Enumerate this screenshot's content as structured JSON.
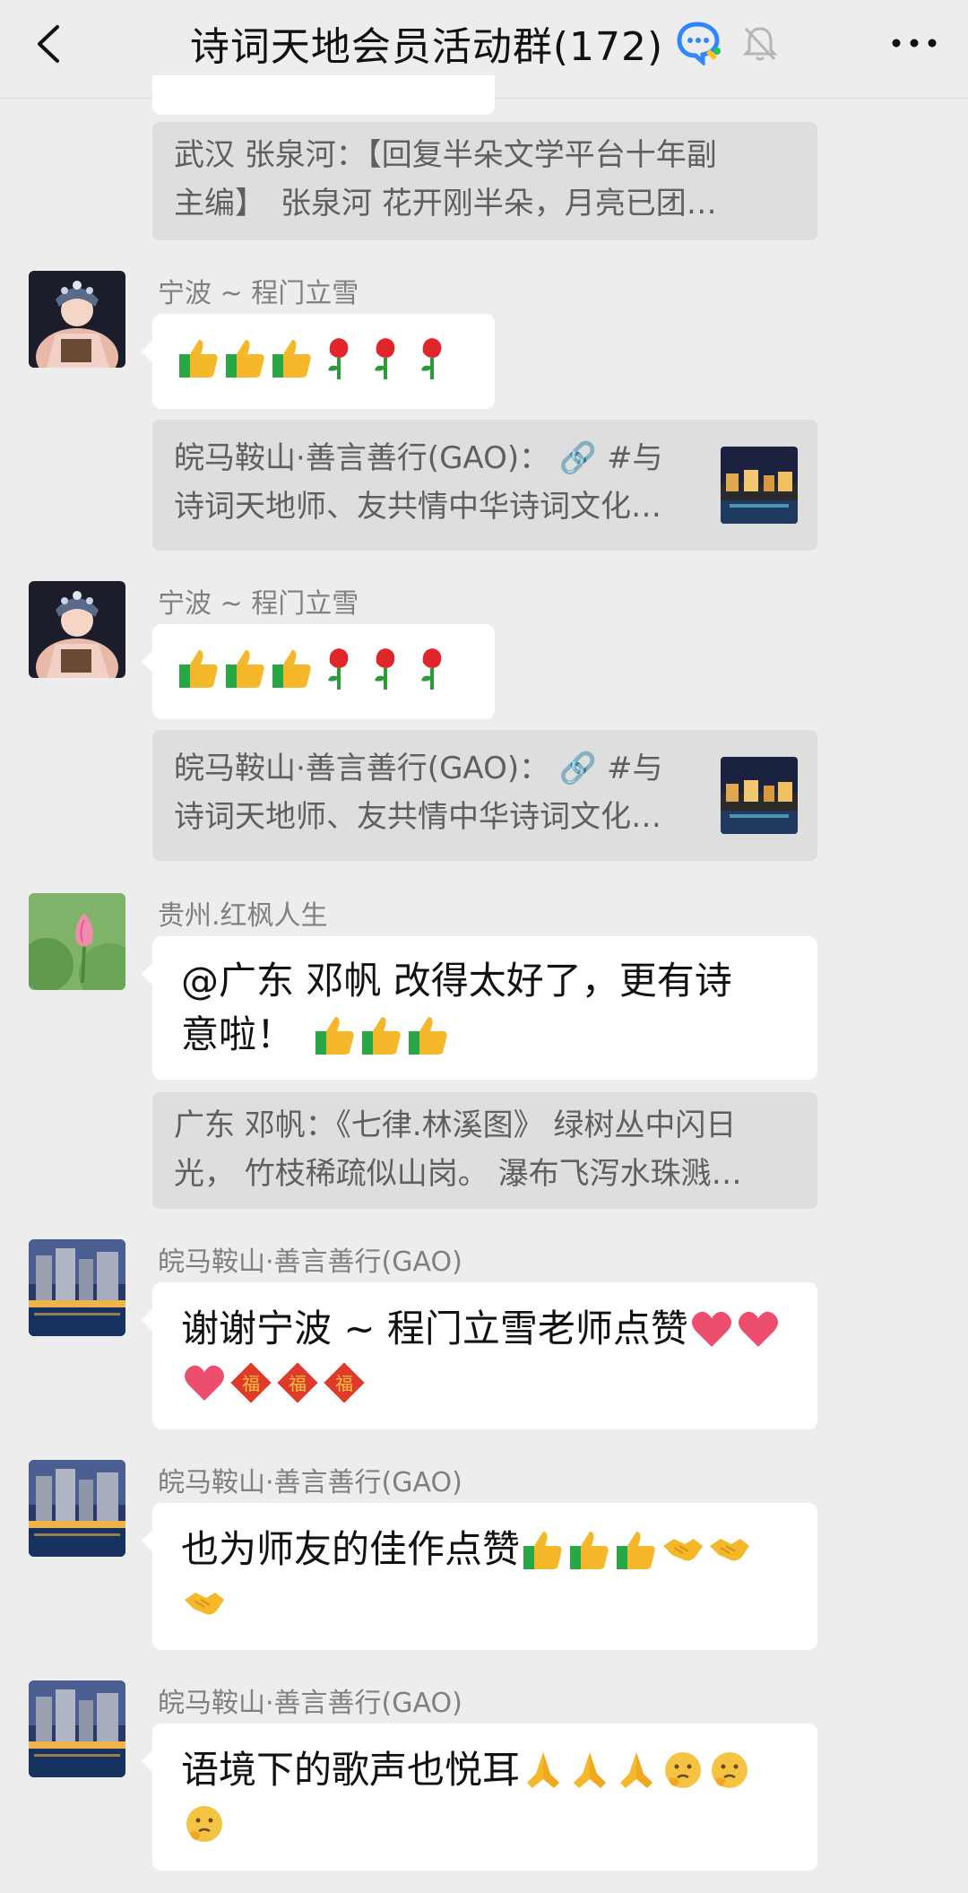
{
  "header": {
    "title": "诗词天地会员活动群(172)",
    "back_icon": "chevron-left-icon",
    "chat_icon": "chat-bubble-icon",
    "mute_icon": "bell-off-icon",
    "more_icon": "more-dots-icon"
  },
  "messages": [
    {
      "quote": {
        "line1": "武汉 张泉河：【回复半朵文学平台十年副",
        "line2": "主编】　张泉河 花开刚半朵，月亮已团…"
      }
    },
    {
      "sender": "宁波 ~ 程门立雪",
      "emojis": [
        "thumbs-up",
        "thumbs-up",
        "thumbs-up",
        "rose",
        "rose",
        "rose"
      ],
      "quote": {
        "line1": "皖马鞍山·善言善行(GAO)： 🔗 #与",
        "line2": "诗词天地师、友共情中华诗词文化…"
      }
    },
    {
      "sender": "宁波 ~ 程门立雪",
      "emojis": [
        "thumbs-up",
        "thumbs-up",
        "thumbs-up",
        "rose",
        "rose",
        "rose"
      ],
      "quote": {
        "line1": "皖马鞍山·善言善行(GAO)： 🔗 #与",
        "line2": "诗词天地师、友共情中华诗词文化…"
      }
    },
    {
      "sender": "贵州.红枫人生",
      "text_line1": "@广东 邓帆  改得太好了，更有诗",
      "text_line2": "意啦！",
      "quote": {
        "line1": "广东 邓帆：《七律.林溪图》 绿树丛中闪日",
        "line2": "光， 竹枝稀疏似山岗。 瀑布飞泻水珠溅…"
      }
    },
    {
      "sender": "皖马鞍山·善言善行(GAO)",
      "text": "谢谢宁波 ~ 程门立雪老师点赞"
    },
    {
      "sender": "皖马鞍山·善言善行(GAO)",
      "text": "也为师友的佳作点赞"
    },
    {
      "sender": "皖马鞍山·善言善行(GAO)",
      "text": "语境下的歌声也悦耳"
    }
  ]
}
